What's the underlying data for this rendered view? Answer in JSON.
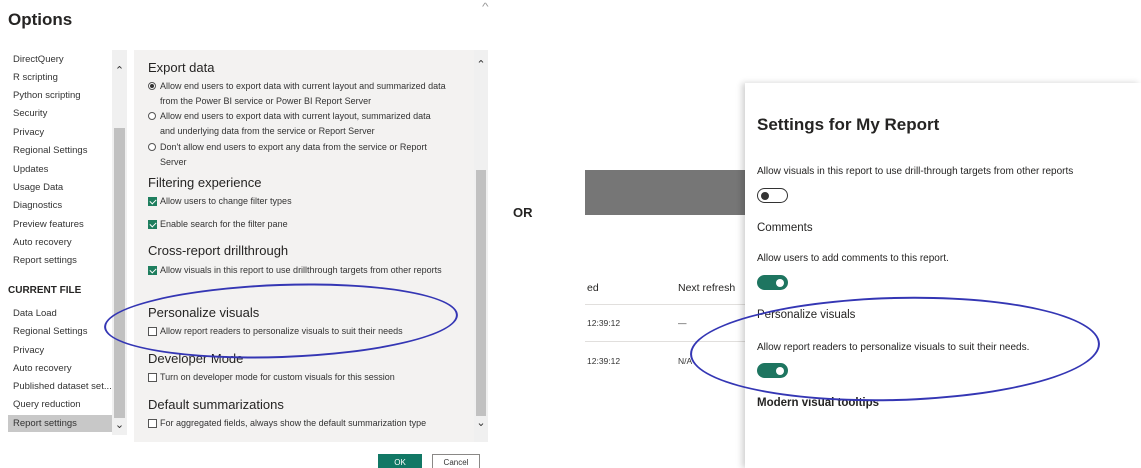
{
  "options_dialog": {
    "title": "Options",
    "nav": {
      "global_items": [
        "DirectQuery",
        "R scripting",
        "Python scripting",
        "Security",
        "Privacy",
        "Regional Settings",
        "Updates",
        "Usage Data",
        "Diagnostics",
        "Preview features",
        "Auto recovery",
        "Report settings"
      ],
      "current_file_header": "CURRENT FILE",
      "current_file_items": [
        "Data Load",
        "Regional Settings",
        "Privacy",
        "Auto recovery",
        "Published dataset set...",
        "Query reduction",
        "Report settings"
      ],
      "selected": "Report settings"
    },
    "sections": [
      {
        "title": "Export data",
        "options": [
          {
            "type": "radio",
            "checked": true,
            "text": "Allow end users to export data with current layout and summarized data from the Power BI service or Power BI Report Server"
          },
          {
            "type": "radio",
            "checked": false,
            "text": "Allow end users to export data with current layout, summarized data and underlying data from the service or Report Server"
          },
          {
            "type": "radio",
            "checked": false,
            "text": "Don't allow end users to export any data from the service or Report Server"
          }
        ]
      },
      {
        "title": "Filtering experience",
        "options": [
          {
            "type": "checkbox",
            "checked": true,
            "text": "Allow users to change filter types"
          },
          {
            "type": "checkbox",
            "checked": true,
            "text": "Enable search for the filter pane"
          }
        ]
      },
      {
        "title": "Cross-report drillthrough",
        "options": [
          {
            "type": "checkbox",
            "checked": true,
            "text": "Allow visuals in this report to use drillthrough targets from other reports"
          }
        ]
      },
      {
        "title": "Personalize visuals",
        "options": [
          {
            "type": "checkbox",
            "checked": false,
            "text": "Allow report readers to personalize visuals to suit their needs"
          }
        ]
      },
      {
        "title": "Developer Mode",
        "options": [
          {
            "type": "checkbox",
            "checked": false,
            "text": "Turn on developer mode for custom visuals for this session"
          }
        ]
      },
      {
        "title": "Default summarizations",
        "options": [
          {
            "type": "checkbox",
            "checked": false,
            "text": "For aggregated fields, always show the default summarization type"
          }
        ]
      }
    ],
    "ok_label": "OK",
    "cancel_label": "Cancel"
  },
  "separator_label": "OR",
  "background_table": {
    "headers": [
      "ed",
      "Next refresh"
    ],
    "rows": [
      {
        "time": "12:39:12",
        "next": "—"
      },
      {
        "time": "12:39:12",
        "next": "N/A"
      }
    ]
  },
  "settings_panel": {
    "title": "Settings for My Report",
    "drillthrough_desc": "Allow visuals in this report to use drill-through targets from other reports",
    "drillthrough_on": false,
    "comments_title": "Comments",
    "comments_desc": "Allow users to add comments to this report.",
    "comments_on": true,
    "personalize_title": "Personalize visuals",
    "personalize_desc": "Allow report readers to personalize visuals to suit their needs.",
    "personalize_on": true,
    "tooltips_title": "Modern visual tooltips"
  },
  "colors": {
    "accent_green": "#117865",
    "annotation_ellipse": "#3436b4",
    "selected_nav": "#c8c8c8"
  }
}
